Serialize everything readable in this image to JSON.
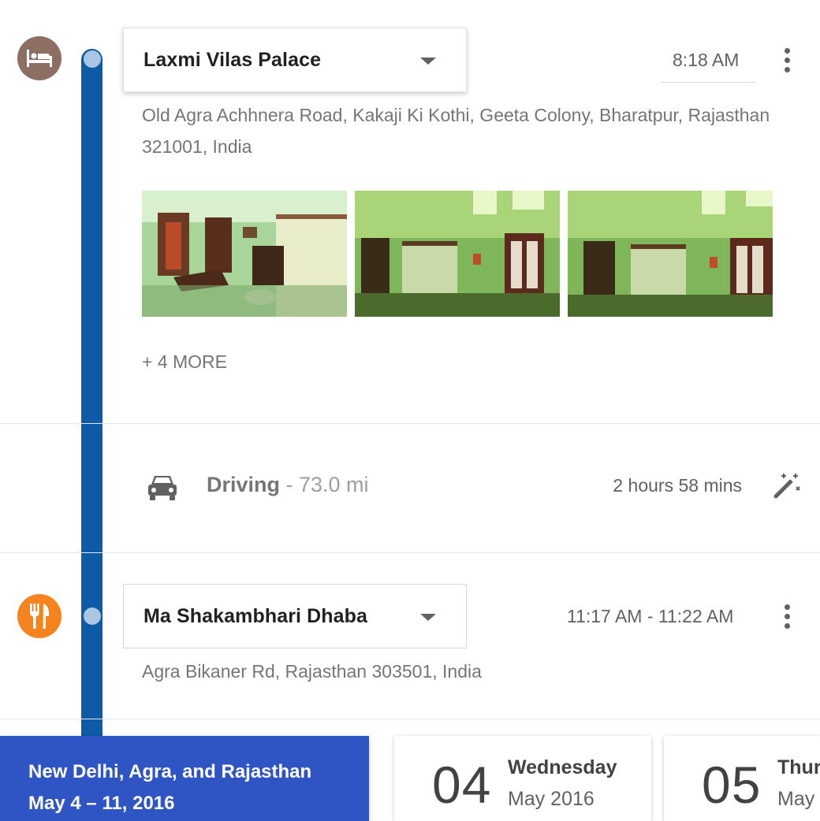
{
  "stops": [
    {
      "name": "Laxmi Vilas Palace",
      "category_icon": "hotel-bed-icon",
      "category_color": "#8d6e63",
      "time": "8:18 AM",
      "address_line1": "Old Agra Achhnera Road, Kakaji Ki Kothi, Geeta Colony, Bharatpur, Rajasthan",
      "address_line2": "321001, India",
      "photos": [
        "hotel-room-photo-1",
        "hotel-room-photo-2",
        "hotel-room-photo-3"
      ],
      "more_label": "+ 4 MORE"
    },
    {
      "name": "Ma Shakambhari Dhaba",
      "category_icon": "restaurant-fork-knife-icon",
      "category_color": "#f5841f",
      "time": "11:17 AM - 11:22 AM",
      "address_line1": "Agra Bikaner Rd, Rajasthan 303501, India"
    }
  ],
  "leg": {
    "mode_icon": "car-icon",
    "mode": "Driving",
    "distance": " - 73.0 mi",
    "duration": "2 hours 58 mins",
    "optimize_icon": "magic-wand-icon"
  },
  "timeline_color": "#0d5aa7",
  "trip": {
    "title": "New Delhi, Agra, and Rajasthan",
    "dates": "May 4 – 11, 2016",
    "color": "#2f55c4"
  },
  "days": [
    {
      "num": "04",
      "weekday": "Wednesday",
      "month": "May 2016"
    },
    {
      "num": "05",
      "weekday": "Thur",
      "month": "May"
    }
  ]
}
